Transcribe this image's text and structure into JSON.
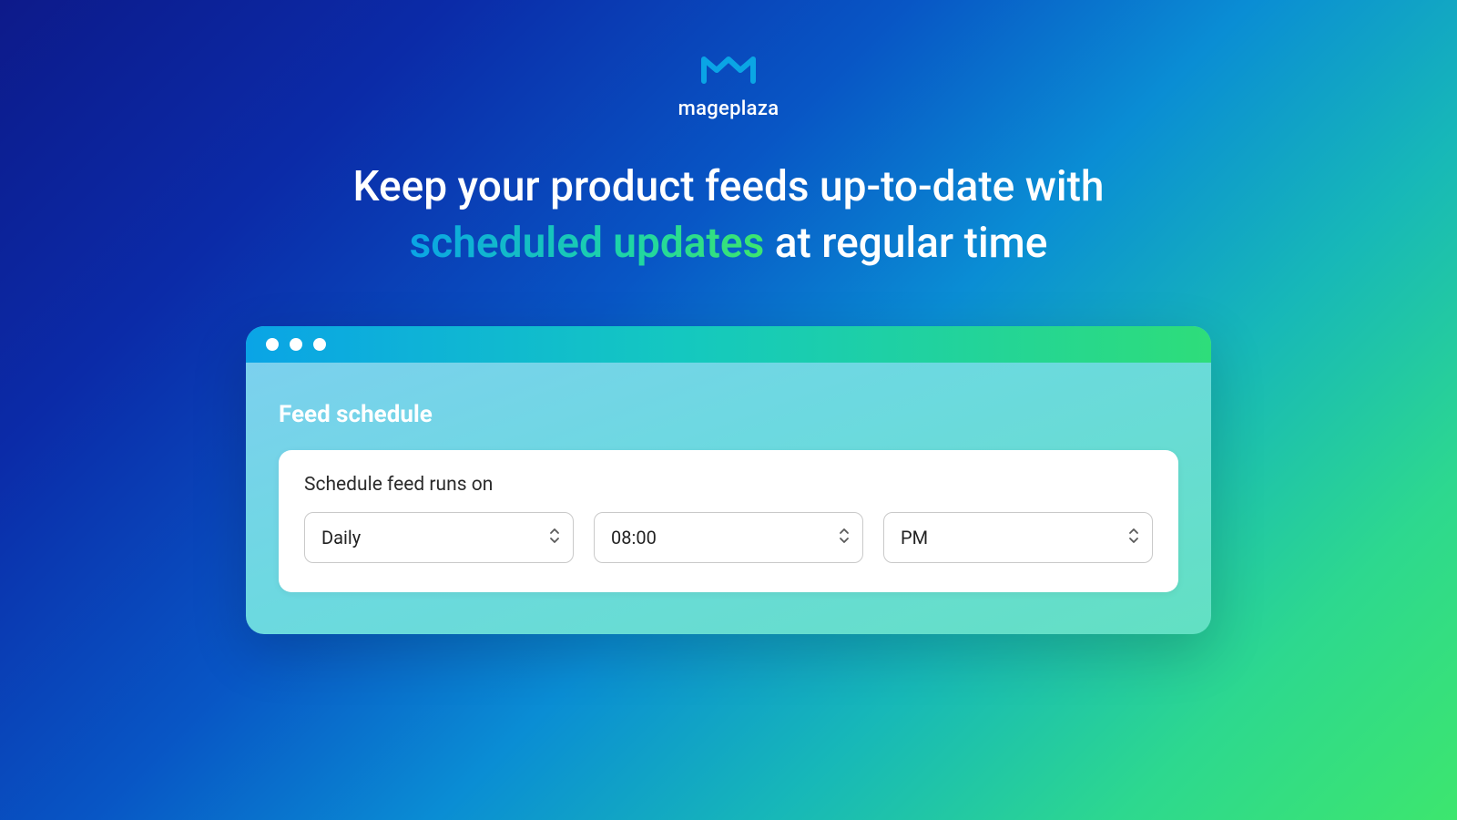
{
  "brand": {
    "name": "mageplaza"
  },
  "headline": {
    "line1": "Keep your product feeds up-to-date with",
    "highlight": "scheduled updates",
    "line2_suffix": " at regular time"
  },
  "card": {
    "section_title": "Feed schedule",
    "field_label": "Schedule feed runs on",
    "selects": {
      "frequency": "Daily",
      "time": "08:00",
      "meridiem": "PM"
    }
  }
}
